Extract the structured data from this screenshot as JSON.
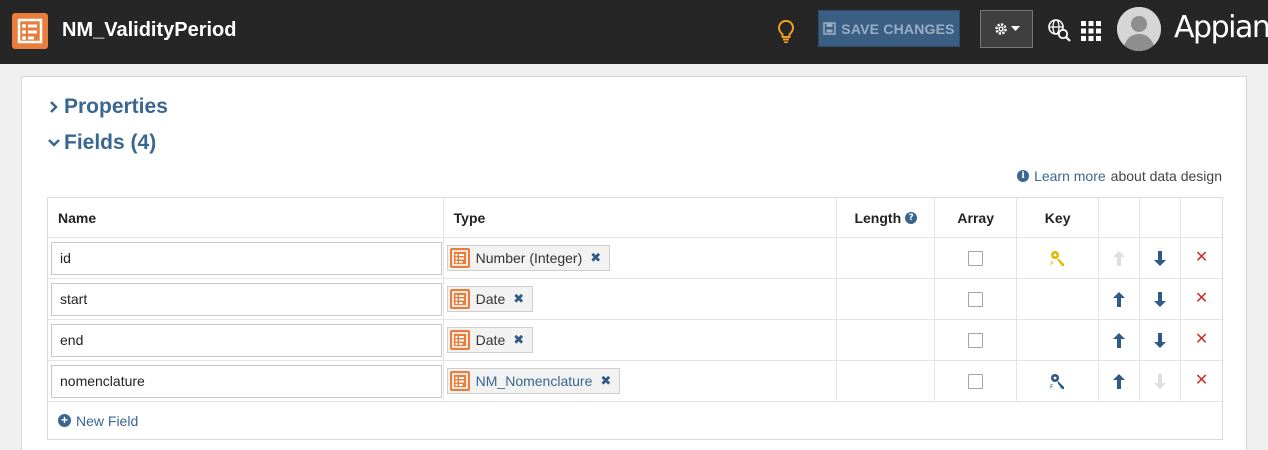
{
  "header": {
    "title": "NM_ValidityPeriod",
    "save_label": "SAVE CHANGES",
    "brand": "Appian",
    "icons": {
      "logo": "data-type-icon",
      "bulb": "lightbulb-icon",
      "save": "save-icon",
      "settings": "gear-icon",
      "globe": "globe-search-icon",
      "apps": "grid-icon",
      "avatar": "user-avatar"
    }
  },
  "sections": {
    "properties": "Properties",
    "fields": "Fields (4)"
  },
  "learn": {
    "link": "Learn more",
    "rest": "about data design"
  },
  "table": {
    "headers": {
      "name": "Name",
      "type": "Type",
      "length": "Length",
      "array": "Array",
      "key": "Key"
    },
    "rows": [
      {
        "name": "id",
        "type": "Number (Integer)",
        "type_is_link": false,
        "array": false,
        "key": "primary-key",
        "up_enabled": false,
        "down_enabled": true
      },
      {
        "name": "start",
        "type": "Date",
        "type_is_link": false,
        "array": false,
        "key": "",
        "up_enabled": true,
        "down_enabled": true
      },
      {
        "name": "end",
        "type": "Date",
        "type_is_link": false,
        "array": false,
        "key": "",
        "up_enabled": true,
        "down_enabled": true
      },
      {
        "name": "nomenclature",
        "type": "NM_Nomenclature",
        "type_is_link": true,
        "array": false,
        "key": "foreign-key",
        "up_enabled": true,
        "down_enabled": false
      }
    ],
    "new_field": "New Field"
  },
  "colors": {
    "header_bg": "#262626",
    "accent_orange": "#e97d3b",
    "link_blue": "#3a6791",
    "delete_red": "#c9302c",
    "key_gold": "#e6b800"
  }
}
